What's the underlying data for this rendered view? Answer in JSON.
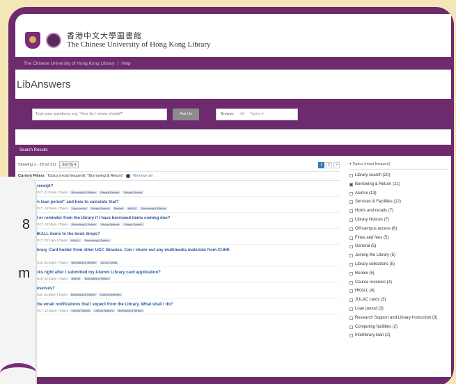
{
  "colors": {
    "brand": "#6d2a6d",
    "link": "#2a5c9e",
    "background": "#f5e6b8"
  },
  "header": {
    "logo_cn": "香港中文大學圖書館",
    "logo_en": "The Chinese University of Hong Kong Library"
  },
  "breadcrumb": {
    "home": "The Chinese University of Hong Kong Library",
    "sep": "/",
    "current": "Help"
  },
  "page_title": "LibAnswers",
  "search": {
    "placeholder": "Type your questions, e.g. \"How do I renew a book?\"",
    "ask_label": "Ask Us",
    "browse_label": "Browse:",
    "all_label": "All",
    "topics_label": "Topics ▾"
  },
  "results": {
    "bar_label": "Search Results",
    "showing": "Showing 1 - 20 (of 21)",
    "sort_label": "Sort By ▾",
    "pages": [
      "1",
      "2",
      "»"
    ],
    "filters_label": "Current Filters",
    "filters_text": "Topics (most frequent): \"Borrowing & Return\"",
    "remove_all": "Remove all",
    "items": [
      {
        "title": "a borrow receipt?",
        "meta": "ated  Sep 05 2017, 11:51am  |  Topics",
        "tags": [
          "Borrowing & Return",
          "Library Notices",
          "Library Search"
        ]
      },
      {
        "title": "\"maximum loan period\" and how to calculate that?",
        "meta": "ated  Dec 18 2017, 10:59am  |  Topics",
        "tags": [
          "Loan period",
          "Library Search",
          "Renew",
          "HKALL",
          "Borrowing & Return"
        ]
      },
      {
        "title": "et an alert or reminder from the library if I have borrowed items coming due?",
        "meta": "ated  Sep 13 2017, 12:52pm  |  Topics",
        "tags": [
          "Borrowing & Return",
          "Library Notices",
          "Library Search"
        ]
      },
      {
        "title": "turn the HKALL items to the book drops?",
        "meta": "ated  Mar 13 2017, 03:11pm  |  Topics",
        "tags": [
          "HKALL",
          "Borrowing & Return"
        ]
      },
      {
        "title": "JULAC Library Card holder from other UGC libraries. Can I check out any multimedia materials from CUHK",
        "title2": "s?",
        "meta": "ated  Feb 18 2016, 02:51pm  |  Topics",
        "tags": [
          "Borrowing & Return",
          "JULAC cards"
        ]
      },
      {
        "title": "orrow books right after I submitted my Alumni Library card application?",
        "meta": "ated  Feb 18 2016, 02:51pm  |  Topics",
        "tags": [
          "Alumni",
          "Borrowing & Return"
        ]
      },
      {
        "title": "Course Reserves?",
        "meta": "ated  Jan 21 2016, 04:59pm  |  Topics",
        "tags": [
          "Borrowing & Return",
          "Course reserves"
        ]
      },
      {
        "title": "t receive the email notifications that I expect from the Library. What shall I do?",
        "meta": "ated  Sep 13 2017, 12:49pm  |  Topics",
        "tags": [
          "Library Search",
          "Library Notices",
          "Borrowing & Return"
        ]
      }
    ]
  },
  "topics": {
    "header": "▾ Topics (most frequent)",
    "items": [
      {
        "label": "Library search (20)",
        "checked": false
      },
      {
        "label": "Borrowing & Return (21)",
        "checked": true
      },
      {
        "label": "Alumni (13)",
        "checked": false
      },
      {
        "label": "Services & Facilities (12)",
        "checked": false
      },
      {
        "label": "Holds and recalls (7)",
        "checked": false
      },
      {
        "label": "Library Notices (7)",
        "checked": false
      },
      {
        "label": "Off-campus access (6)",
        "checked": false
      },
      {
        "label": "Fines and fees (5)",
        "checked": false
      },
      {
        "label": "General (5)",
        "checked": false
      },
      {
        "label": "Joining the Library (5)",
        "checked": false
      },
      {
        "label": "Library collections (5)",
        "checked": false
      },
      {
        "label": "Renew (5)",
        "checked": false
      },
      {
        "label": "Course reserves (4)",
        "checked": false
      },
      {
        "label": "HKALL (4)",
        "checked": false
      },
      {
        "label": "JULAC cards (3)",
        "checked": false
      },
      {
        "label": "Loan period (3)",
        "checked": false
      },
      {
        "label": "Research Support and Library Instruction (3)",
        "checked": false
      },
      {
        "label": "Computing facilities (2)",
        "checked": false
      },
      {
        "label": "Interlibrary loan (2)",
        "checked": false
      }
    ]
  },
  "overlay": {
    "line1": "8",
    "line2": "m"
  }
}
